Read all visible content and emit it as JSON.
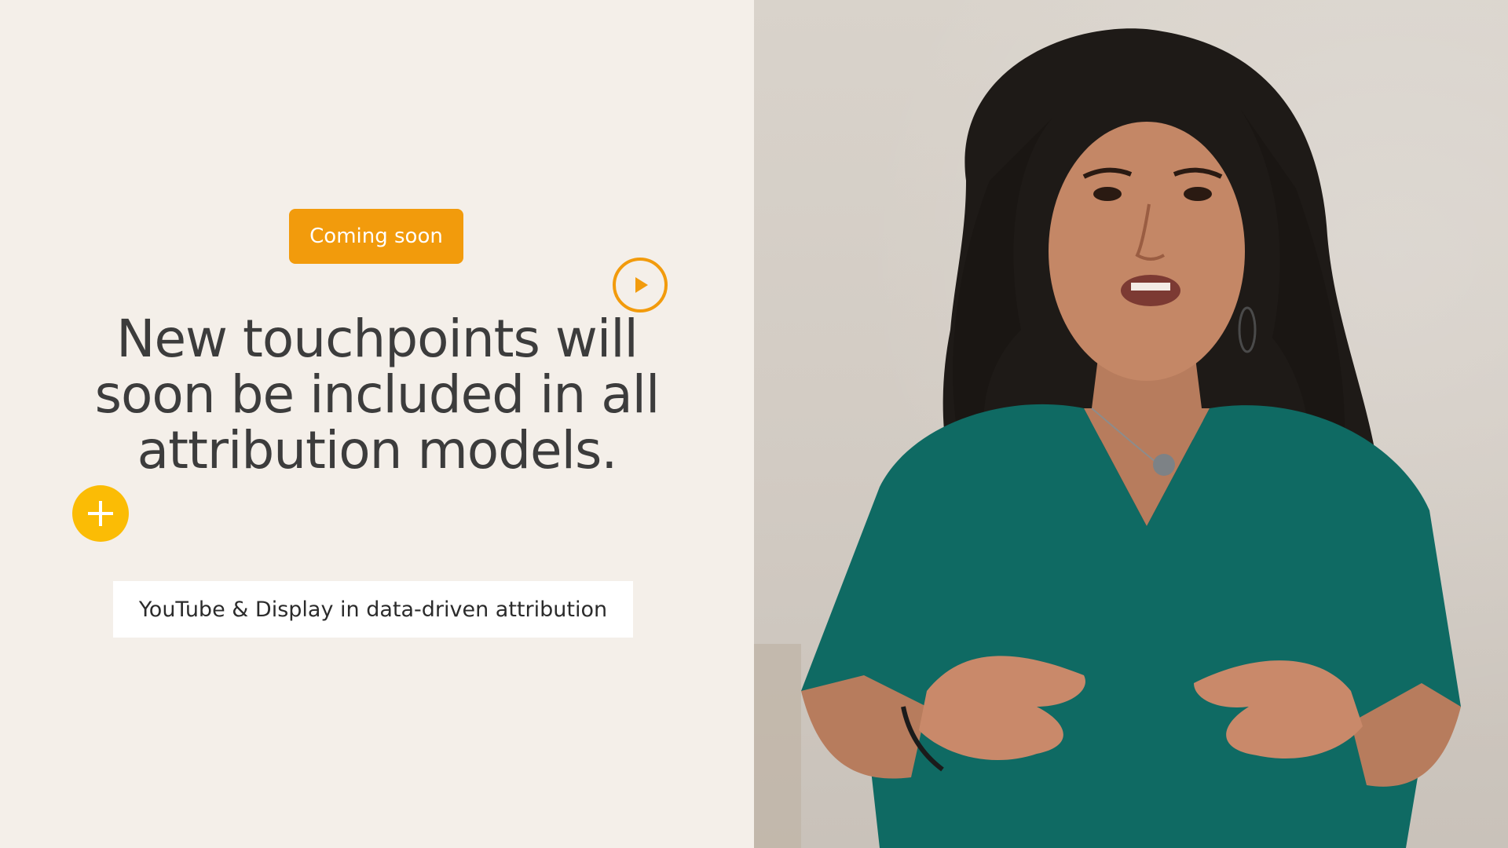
{
  "slide": {
    "badge_label": "Coming soon",
    "headline": "New touchpoints will soon be included in all attribution models.",
    "subtitle": "YouTube & Display in data-driven attribution",
    "icons": {
      "play": "play-circle-icon",
      "plus": "plus-circle-icon"
    },
    "colors": {
      "background": "#f4efe9",
      "accent_orange": "#f29b0c",
      "accent_yellow": "#fbbc05",
      "headline_text": "#3c3c3c",
      "shirt_teal": "#0f6a63"
    }
  }
}
